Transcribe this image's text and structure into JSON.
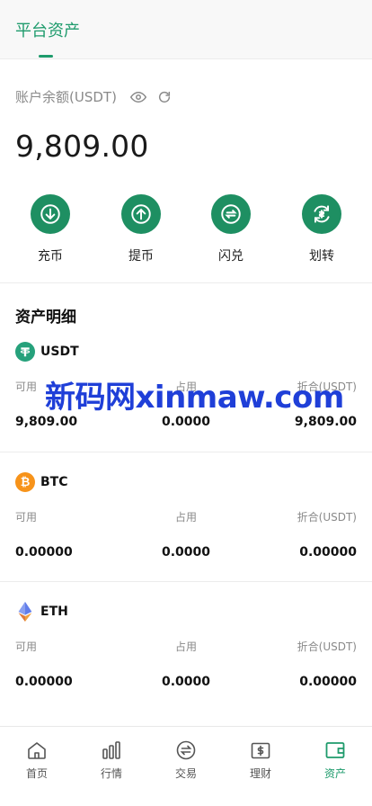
{
  "header": {
    "tab_label": "平台资产"
  },
  "balance": {
    "label": "账户余额(USDT)",
    "value": "9,809.00"
  },
  "actions": [
    {
      "label": "充币",
      "icon": "deposit-icon"
    },
    {
      "label": "提币",
      "icon": "withdraw-icon"
    },
    {
      "label": "闪兑",
      "icon": "swap-icon"
    },
    {
      "label": "划转",
      "icon": "transfer-icon"
    }
  ],
  "assets_title": "资产明细",
  "columns": {
    "available": "可用",
    "occupied": "占用",
    "converted": "折合(USDT)"
  },
  "assets": [
    {
      "name": "USDT",
      "available": "9,809.00",
      "occupied": "0.0000",
      "converted": "9,809.00",
      "color": "#26a17b"
    },
    {
      "name": "BTC",
      "available": "0.00000",
      "occupied": "0.0000",
      "converted": "0.00000",
      "color": "#f7931a"
    },
    {
      "name": "ETH",
      "available": "0.00000",
      "occupied": "0.0000",
      "converted": "0.00000",
      "color": "#627eea"
    }
  ],
  "watermark": "新码网xinmaw.com",
  "tabbar": [
    {
      "label": "首页",
      "icon": "home-icon"
    },
    {
      "label": "行情",
      "icon": "market-icon"
    },
    {
      "label": "交易",
      "icon": "trade-icon"
    },
    {
      "label": "理财",
      "icon": "finance-icon"
    },
    {
      "label": "资产",
      "icon": "wallet-icon",
      "active": true
    }
  ],
  "colors": {
    "accent": "#1e9b6c",
    "action_bg": "#1e8f62"
  }
}
